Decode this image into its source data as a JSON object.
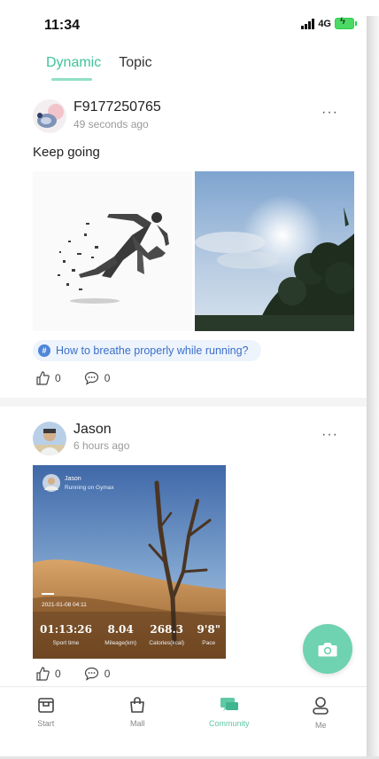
{
  "status": {
    "time": "11:34",
    "network": "4G"
  },
  "tabs": [
    {
      "label": "Dynamic",
      "active": true
    },
    {
      "label": "Topic",
      "active": false
    }
  ],
  "posts": [
    {
      "author": "F9177250765",
      "time": "49 seconds ago",
      "text": "Keep going",
      "topic": "How to breathe properly while running?",
      "likes": "0",
      "comments": "0"
    },
    {
      "author": "Jason",
      "time": "6 hours ago",
      "likes": "0",
      "comments": "0",
      "card": {
        "name": "Jason",
        "subtitle": "Running on Gymax",
        "date": "2021-01-08 04:11",
        "stats": [
          {
            "value": "01:13:26",
            "label": "Sport time"
          },
          {
            "value": "8.04",
            "label": "Mileage(km)"
          },
          {
            "value": "268.3",
            "label": "Calories(kcal)"
          },
          {
            "value": "9'8\"",
            "label": "Pace"
          }
        ]
      }
    }
  ],
  "more_glyph": "···",
  "nav": [
    {
      "label": "Start",
      "icon": "start-icon",
      "active": false
    },
    {
      "label": "Mall",
      "icon": "bag-icon",
      "active": false
    },
    {
      "label": "Community",
      "icon": "chat-icon",
      "active": true
    },
    {
      "label": "Me",
      "icon": "user-icon",
      "active": false
    }
  ],
  "colors": {
    "accent": "#3fc49b",
    "fab": "#6fd2b0",
    "topic": "#3a6fc8"
  }
}
